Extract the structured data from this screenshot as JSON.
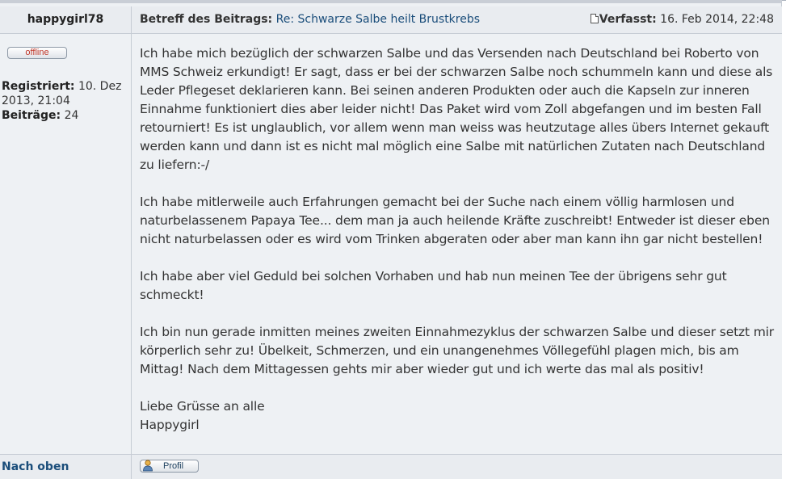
{
  "post": {
    "author": "happygirl78",
    "subject_label": "Betreff des Beitrags:",
    "subject": "Re: Schwarze Salbe heilt Brustkrebs",
    "posted_label": "Verfasst:",
    "posted_date": "16. Feb 2014, 22:48"
  },
  "profile": {
    "status": "offline",
    "registered_label": "Registriert:",
    "registered_value": "10. Dez 2013, 21:04",
    "posts_label": "Beiträge:",
    "posts_value": "24"
  },
  "message": {
    "paragraphs": [
      "Ich habe mich bezüglich der schwarzen Salbe und das Versenden nach Deutschland bei Roberto von MMS Schweiz erkundigt! Er sagt, dass er bei der schwarzen Salbe noch schummeln kann und diese als Leder Pflegeset deklarieren kann. Bei seinen anderen Produkten oder auch die Kapseln zur inneren Einnahme funktioniert dies aber leider nicht! Das Paket wird vom Zoll abgefangen und im besten Fall retourniert! Es ist unglaublich, vor allem wenn man weiss was heutzutage alles übers Internet gekauft werden kann und dann ist es nicht mal möglich eine Salbe mit natürlichen Zutaten nach Deutschland zu liefern:-/",
      "Ich habe mitlerweile auch Erfahrungen gemacht bei der Suche nach einem völlig harmlosen und naturbelassenem Papaya Tee... dem man ja auch heilende Kräfte zuschreibt! Entweder ist dieser eben nicht naturbelassen oder es wird vom Trinken abgeraten oder aber man kann ihn gar nicht bestellen!",
      "Ich habe aber viel Geduld bei solchen Vorhaben und hab nun meinen Tee der übrigens sehr gut schmeckt!",
      "Ich bin nun gerade inmitten meines zweiten Einnahmezyklus der schwarzen Salbe und dieser setzt mir körperlich sehr zu! Übelkeit, Schmerzen, und ein unangenehmes Völlegefühl plagen mich, bis am Mittag! Nach dem Mittagessen gehts mir aber wieder gut und ich werte das mal als positiv!",
      "Liebe Grüsse an alle",
      "Happygirl"
    ]
  },
  "footer": {
    "top_link": "Nach oben",
    "profile_button": "Profil"
  },
  "icons": {
    "post_icon": "document-icon",
    "profile_button_icon": "user-icon"
  },
  "colors": {
    "link": "#1a4d7a",
    "offline": "#c0392b",
    "background": "#eef1f4"
  }
}
